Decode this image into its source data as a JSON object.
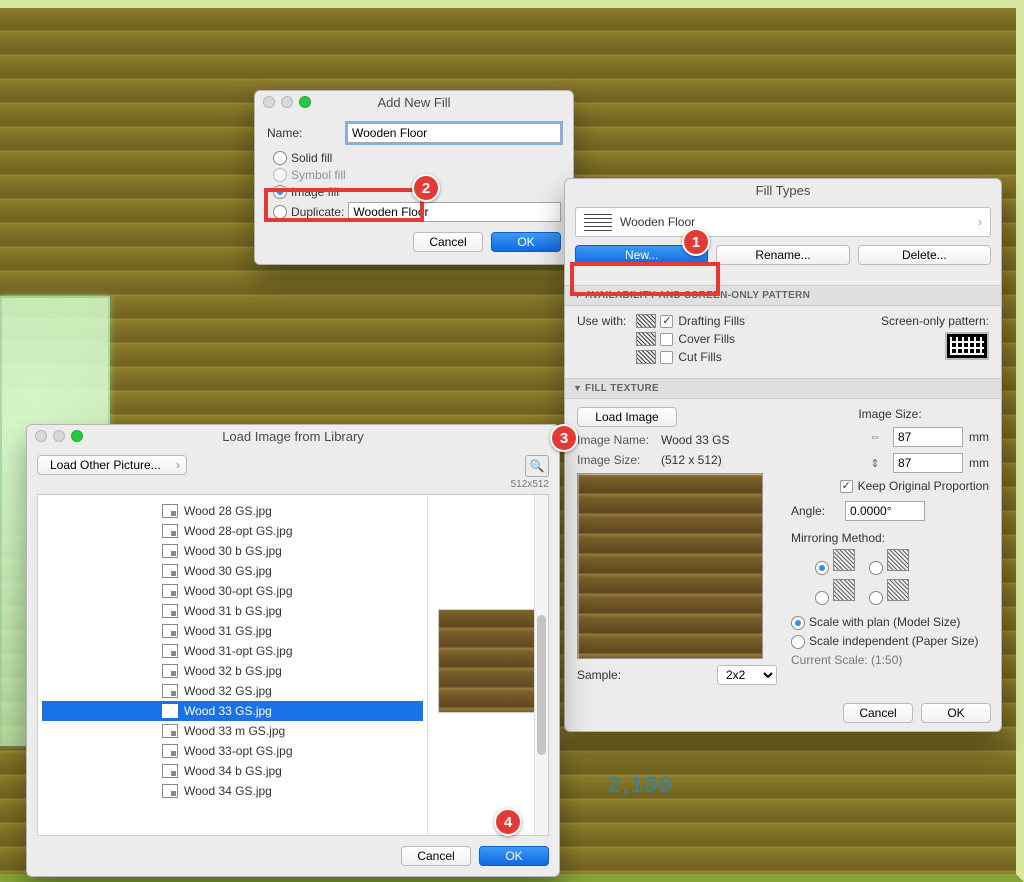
{
  "stage": {
    "dimension": "2,100"
  },
  "addFill": {
    "title": "Add New Fill",
    "nameLabel": "Name:",
    "nameValue": "Wooden Floor",
    "options": {
      "solid": "Solid fill",
      "symbol": "Symbol fill",
      "image": "Image fill"
    },
    "dupLabel": "Duplicate:",
    "dupValue": "Wooden Floor",
    "cancel": "Cancel",
    "ok": "OK"
  },
  "fillTypes": {
    "title": "Fill Types",
    "currentName": "Wooden Floor",
    "newBtn": "New...",
    "renameBtn": "Rename...",
    "deleteBtn": "Delete...",
    "availHeader": "AVAILABILITY AND SCREEN-ONLY PATTERN",
    "useWith": "Use with:",
    "drafting": "Drafting Fills",
    "cover": "Cover Fills",
    "cut": "Cut Fills",
    "screenOnly": "Screen-only pattern:",
    "texHeader": "FILL TEXTURE",
    "loadImage": "Load Image",
    "imageNameL": "Image Name:",
    "imageNameV": "Wood 33 GS",
    "imageSizeL": "Image Size:",
    "imageSizeV": "(512 x 512)",
    "sampleL": "Sample:",
    "sampleV": "2x2",
    "sizeHeader": "Image Size:",
    "width": "87",
    "height": "87",
    "unit": "mm",
    "keepProp": "Keep Original Proportion",
    "angleL": "Angle:",
    "angleV": "0.0000°",
    "mirrorL": "Mirroring Method:",
    "scalePlan": "Scale with plan (Model Size)",
    "scaleInd": "Scale independent (Paper Size)",
    "curScale": "Current Scale: (1:50)",
    "cancel": "Cancel",
    "ok": "OK"
  },
  "loadImage": {
    "title": "Load Image from Library",
    "loadOther": "Load Other Picture...",
    "dims": "512x512",
    "files": [
      "Wood 28 GS.jpg",
      "Wood 28-opt GS.jpg",
      "Wood 30 b GS.jpg",
      "Wood 30 GS.jpg",
      "Wood 30-opt GS.jpg",
      "Wood 31 b GS.jpg",
      "Wood 31 GS.jpg",
      "Wood 31-opt GS.jpg",
      "Wood 32 b GS.jpg",
      "Wood 32 GS.jpg",
      "Wood 33 GS.jpg",
      "Wood 33 m GS.jpg",
      "Wood 33-opt GS.jpg",
      "Wood 34 b GS.jpg",
      "Wood 34 GS.jpg"
    ],
    "selectedIndex": 10,
    "cancel": "Cancel",
    "ok": "OK"
  },
  "badges": {
    "b1": "1",
    "b2": "2",
    "b3": "3",
    "b4": "4"
  }
}
